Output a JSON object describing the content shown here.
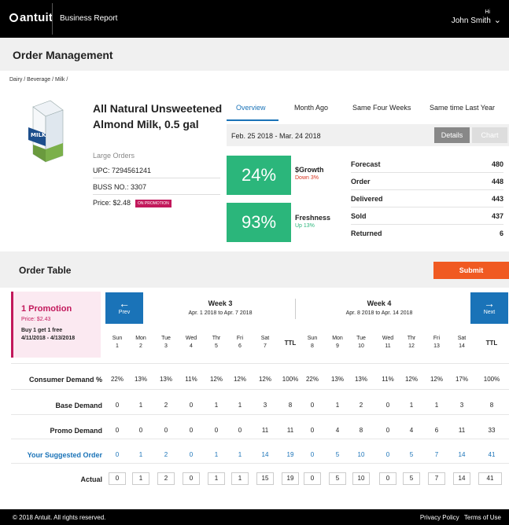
{
  "topbar": {
    "logo": "antuit",
    "subtitle": "Business Report",
    "greeting": "Hi",
    "user_name": "John Smith"
  },
  "page": {
    "title": "Order Management",
    "breadcrumb": "Dairy / Beverage / Milk /"
  },
  "product": {
    "name_line1": "All Natural Unsweetened",
    "name_line2": "Almond Milk, 0.5 gal",
    "type": "Large Orders",
    "upc": "UPC: 7294561241",
    "buss_no": "BUSS NO.: 3307",
    "price": "Price: $2.48",
    "badge": "ON PROMOTION",
    "carton_label": "MILK"
  },
  "tabs": [
    "Overview",
    "Month Ago",
    "Same Four Weeks",
    "Same time Last Year"
  ],
  "date_range": "Feb. 25 2018 - Mar. 24 2018",
  "buttons": {
    "details": "Details",
    "chart": "Chart",
    "submit": "Submit",
    "prev": "Prev",
    "next": "Next"
  },
  "metrics": [
    {
      "value": "24%",
      "label": "$Growth",
      "sub": "Down 3%",
      "sub_color": "#d9331f"
    },
    {
      "value": "93%",
      "label": "Freshness",
      "sub": "Up 13%",
      "sub_color": "#2bb67b"
    }
  ],
  "stats": [
    {
      "label": "Forecast",
      "value": "480"
    },
    {
      "label": "Order",
      "value": "448"
    },
    {
      "label": "Delivered",
      "value": "443"
    },
    {
      "label": "Sold",
      "value": "437"
    },
    {
      "label": "Returned",
      "value": "6"
    }
  ],
  "order_table": {
    "title": "Order Table",
    "promotion": {
      "title": "1 Promotion",
      "price": "Price: $2.43",
      "deal": "Buy 1 get 1 free",
      "dates": "4/11/2018 - 4/13/2018"
    },
    "weeks": [
      {
        "title": "Week 3",
        "range": "Apr. 1 2018 to Apr. 7 2018"
      },
      {
        "title": "Week 4",
        "range": "Apr. 8 2018 to Apr. 14 2018"
      }
    ],
    "days": [
      {
        "d": "Sun",
        "n": "1"
      },
      {
        "d": "Mon",
        "n": "2"
      },
      {
        "d": "Tue",
        "n": "3"
      },
      {
        "d": "Wed",
        "n": "4"
      },
      {
        "d": "Thr",
        "n": "5"
      },
      {
        "d": "Fri",
        "n": "6"
      },
      {
        "d": "Sat",
        "n": "7"
      },
      {
        "d": "TTL",
        "n": ""
      },
      {
        "d": "Sun",
        "n": "8"
      },
      {
        "d": "Mon",
        "n": "9"
      },
      {
        "d": "Tue",
        "n": "10"
      },
      {
        "d": "Wed",
        "n": "11"
      },
      {
        "d": "Thr",
        "n": "12"
      },
      {
        "d": "Fri",
        "n": "13"
      },
      {
        "d": "Sat",
        "n": "14"
      },
      {
        "d": "TTL",
        "n": ""
      }
    ],
    "rows": [
      {
        "label": "Consumer Demand %",
        "style": "plain",
        "values": [
          "22%",
          "13%",
          "13%",
          "11%",
          "12%",
          "12%",
          "12%",
          "100%",
          "22%",
          "13%",
          "13%",
          "11%",
          "12%",
          "12%",
          "17%",
          "100%"
        ]
      },
      {
        "label": "Base Demand",
        "style": "plain",
        "values": [
          "0",
          "1",
          "2",
          "0",
          "1",
          "1",
          "3",
          "8",
          "0",
          "1",
          "2",
          "0",
          "1",
          "1",
          "3",
          "8"
        ]
      },
      {
        "label": "Promo Demand",
        "style": "plain",
        "values": [
          "0",
          "0",
          "0",
          "0",
          "0",
          "0",
          "11",
          "11",
          "0",
          "4",
          "8",
          "0",
          "4",
          "6",
          "11",
          "33"
        ]
      },
      {
        "label": "Your Suggested Order",
        "style": "blue",
        "values": [
          "0",
          "1",
          "2",
          "0",
          "1",
          "1",
          "14",
          "19",
          "0",
          "5",
          "10",
          "0",
          "5",
          "7",
          "14",
          "41"
        ]
      },
      {
        "label": "Actual",
        "style": "box",
        "values": [
          "0",
          "1",
          "2",
          "0",
          "1",
          "1",
          "15",
          "19",
          "0",
          "5",
          "10",
          "0",
          "5",
          "7",
          "14",
          "41"
        ]
      }
    ]
  },
  "footer": {
    "copyright": "© 2018 Antuit. All rights reserved.",
    "privacy": "Privacy Policy",
    "terms": "Terms of Use"
  }
}
